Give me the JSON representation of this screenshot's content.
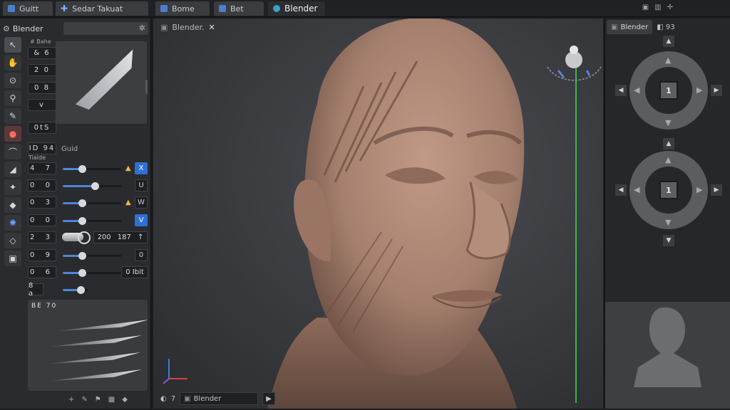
{
  "tabs": [
    {
      "label": "Guitt",
      "icon": "document-icon"
    },
    {
      "label": "Sedar Takuat",
      "icon": "cross-icon"
    },
    {
      "label": "Bome",
      "icon": "document-icon"
    },
    {
      "label": "Bet",
      "icon": "document-icon"
    },
    {
      "label": "Blender",
      "icon": "blender-logo-icon"
    }
  ],
  "left_panel": {
    "title": "Blender",
    "subtitle": "# Bahe",
    "mini_fields": [
      "& 6",
      "2 0",
      "0 8",
      "v",
      "0tS"
    ],
    "section_label": "Guid",
    "small_label": "Tialde",
    "header_field": "ID 94",
    "rows": [
      {
        "value": "4 7",
        "slider": 0.33,
        "toggle": "X",
        "toggle_state": "on",
        "accent": "▲"
      },
      {
        "value": "0 0",
        "slider": 0.55,
        "toggle": "U"
      },
      {
        "value": "0 3",
        "slider": 0.33,
        "toggle": "W",
        "accent": "▲"
      },
      {
        "value": "0 0",
        "slider": 0.33,
        "toggle": "V",
        "toggle_state": "on"
      },
      {
        "value": "2 3",
        "wide": [
          "200",
          "187"
        ]
      },
      {
        "value": "0 9",
        "slider": 0.33,
        "toggle": "0"
      },
      {
        "value": "0 6",
        "slider": 0.33,
        "wide_label": "0 Ibit"
      },
      {
        "value": "8 a",
        "slider": 0.33
      }
    ],
    "alpha_label": "BE 70",
    "bottom_icons": [
      "+",
      "✎",
      "⚑",
      "▦",
      "◆"
    ]
  },
  "viewport": {
    "label": "Blender.",
    "footer_value": "7",
    "footer_field": "Blender"
  },
  "right_panel": {
    "tab_label": "Blender",
    "tab2_label": "93",
    "dial_value": "1",
    "dial2_value": "1"
  },
  "colors": {
    "accent_blue": "#4e86d8",
    "toggle_blue": "#2f6fd6",
    "guide_green": "#3ab54a",
    "warning_yellow": "#f1b73c",
    "skin": "#b08a78"
  }
}
